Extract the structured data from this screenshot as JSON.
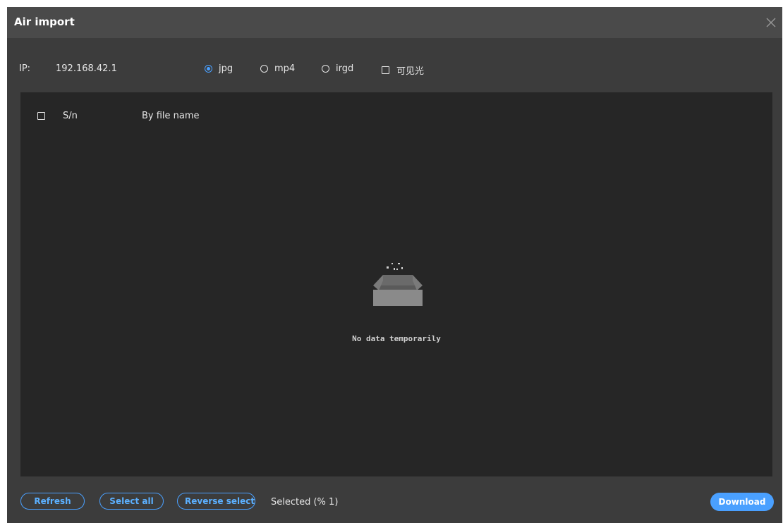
{
  "dialog": {
    "title": "Air import"
  },
  "toolbar": {
    "ip_label": "IP:",
    "ip_value": "192.168.42.1",
    "options": {
      "jpg": {
        "label": "jpg",
        "checked": true
      },
      "mp4": {
        "label": "mp4",
        "checked": false
      },
      "irgd": {
        "label": "irgd",
        "checked": false
      },
      "visible": {
        "label": "可见光",
        "checked": false
      }
    }
  },
  "table": {
    "columns": {
      "sn": "S/n",
      "name": "By file name"
    },
    "empty_text": "No data temporarily"
  },
  "footer": {
    "refresh_label": "Refresh",
    "select_all_label": "Select all",
    "reverse_select_label": "Reverse select",
    "selected_text": "Selected (% 1)",
    "download_label": "Download"
  },
  "colors": {
    "accent": "#4aa0ff",
    "dialog_bg": "#3c3c3c",
    "panel_bg": "#262626",
    "titlebar_bg": "#4a4a4a"
  },
  "icons": {
    "close": "close-icon",
    "empty": "empty-box-icon"
  }
}
